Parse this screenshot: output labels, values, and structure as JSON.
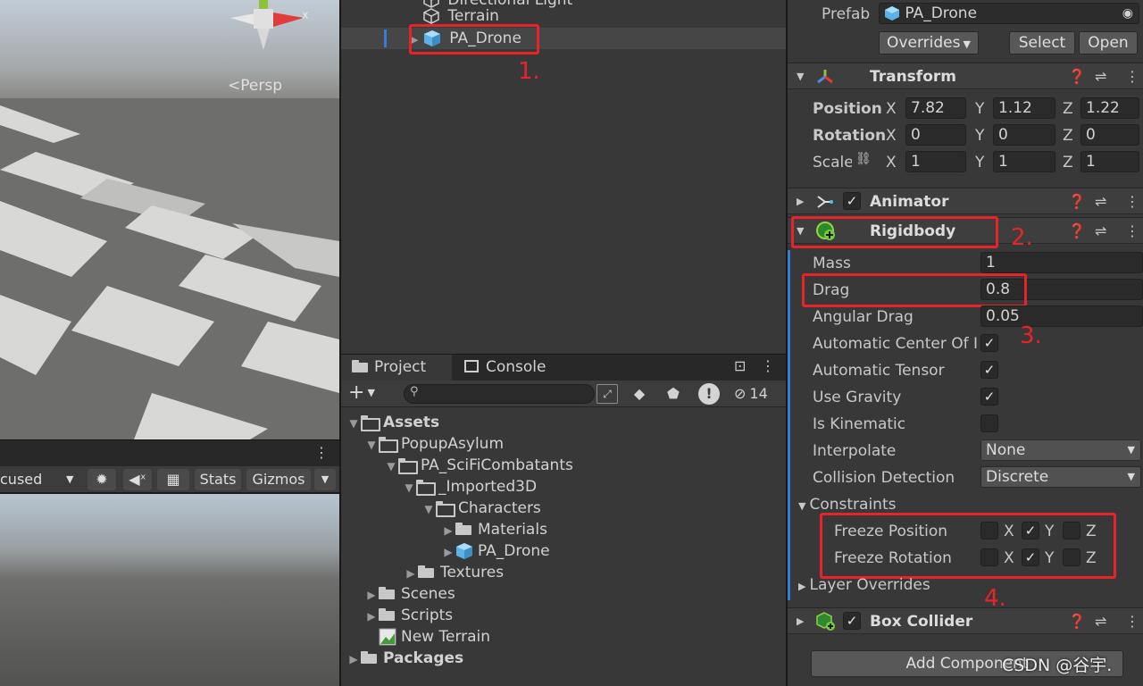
{
  "scene": {
    "persp_label": "<Persp",
    "gizmo_x": "x"
  },
  "game_toolbar": {
    "focused": "cused",
    "stats": "Stats",
    "gizmos": "Gizmos"
  },
  "hierarchy": {
    "items": [
      {
        "label": "Directional Light"
      },
      {
        "label": "Terrain"
      },
      {
        "label": "PA_Drone"
      }
    ]
  },
  "project": {
    "tab_project": "Project",
    "tab_console": "Console",
    "hidden_count": "14",
    "tree": [
      {
        "label": "Assets"
      },
      {
        "label": "PopupAsylum"
      },
      {
        "label": "PA_SciFiCombatants"
      },
      {
        "label": "_Imported3D"
      },
      {
        "label": "Characters"
      },
      {
        "label": "Materials"
      },
      {
        "label": "PA_Drone"
      },
      {
        "label": "Textures"
      },
      {
        "label": "Scenes"
      },
      {
        "label": "Scripts"
      },
      {
        "label": "New Terrain"
      },
      {
        "label": "Packages"
      }
    ]
  },
  "inspector": {
    "prefab_label": "Prefab",
    "prefab_value": "PA_Drone",
    "overrides": "Overrides",
    "select": "Select",
    "open": "Open",
    "transform": {
      "title": "Transform",
      "position": "Position",
      "rotation": "Rotation",
      "scale": "Scale",
      "pos": [
        "7.82",
        "1.12",
        "1.22"
      ],
      "rot": [
        "0",
        "0",
        "0"
      ],
      "scl": [
        "1",
        "1",
        "1"
      ],
      "x": "X",
      "y": "Y",
      "z": "Z"
    },
    "animator": {
      "title": "Animator"
    },
    "rigidbody": {
      "title": "Rigidbody",
      "mass_label": "Mass",
      "mass": "1",
      "drag_label": "Drag",
      "drag": "0.8",
      "angular_drag_label": "Angular Drag",
      "angular_drag": "0.05",
      "auto_center_label": "Automatic Center Of I",
      "auto_tensor_label": "Automatic Tensor",
      "use_gravity_label": "Use Gravity",
      "is_kinematic_label": "Is Kinematic",
      "interpolate_label": "Interpolate",
      "interpolate": "None",
      "collision_label": "Collision Detection",
      "collision": "Discrete",
      "constraints_label": "Constraints",
      "freeze_position_label": "Freeze Position",
      "freeze_rotation_label": "Freeze Rotation",
      "layer_overrides_label": "Layer Overrides"
    },
    "box_collider": {
      "title": "Box Collider"
    },
    "add_component": "Add Component"
  },
  "annotations": {
    "a1": "1.",
    "a2": "2.",
    "a3": "3.",
    "a4": "4."
  },
  "watermark": "CSDN @谷宇."
}
